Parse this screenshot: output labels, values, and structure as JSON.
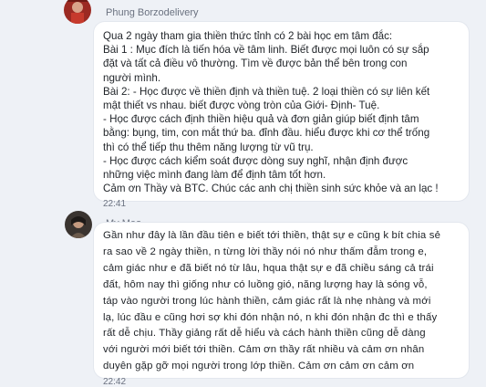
{
  "messages": [
    {
      "sender": "Phung Borzodelivery",
      "avatar": "avatar-photo-red",
      "lines": [
        "Qua 2 ngày tham gia thiền thức tỉnh có 2 bài học em tâm đắc:",
        "Bài 1 : Mục đích là tiến hóa về tâm linh. Biết được mọi luôn có sự sắp",
        "đặt và tất cả điều vô thường. Tìm về được bản thể bên trong con",
        "người mình.",
        "Bài 2: - Học được về thiền định và thiền tuệ. 2 loại thiền có sự liên kết",
        "mật thiết vs nhau. biết được vòng tròn của Giới- Định- Tuệ.",
        "- Học được cách định thiền hiệu quả và đơn giản giúp biết định tâm",
        "bằng: bụng, tim, con mắt thứ ba. đỉnh đầu. hiểu được khi cơ thể trống",
        "thì có thể tiếp thu thêm năng lượng từ vũ trụ.",
        "- Học được cách kiểm soát được dòng suy nghĩ, nhận định được",
        "những việc mình đang làm để định tâm tốt hơn.",
        "Cảm ơn Thầy và BTC. Chúc các anh chị thiền sinh sức khỏe và an lạc !"
      ],
      "time": "22:41"
    },
    {
      "sender": "My Meo",
      "avatar": "avatar-photo-dark",
      "lines": [
        "Gần như đây là lần đầu tiên e biết tới thiền, thật sự e cũng k bít chia sẻ",
        "ra sao về 2 ngày thiền, n từng lời thầy nói nó như thấm đẫm trong e,",
        "cảm giác như e đã biết nó từ lâu, hqua thật sự e đã chiều sáng cả trái",
        "đất, hôm nay thì giống như có luồng gió, năng lượng hay là sóng vỗ,",
        "táp vào người trong lúc hành thiền, cảm giác rất là nhẹ nhàng và mới",
        "lạ, lúc đầu e cũng hơi sợ khi đón nhận nó, n khi đón nhận đc thì e thấy",
        "rất dễ chịu. Thầy giảng rất dễ hiểu và cách hành thiền cũng dễ dàng",
        "với người mới biết tới thiền. Cảm ơn thầy rất nhiều và cảm ơn nhân",
        "duyên gặp gỡ mọi người trong lớp thiền. Cảm ơn cảm ơn cảm ơn"
      ],
      "time": "22:42"
    }
  ]
}
